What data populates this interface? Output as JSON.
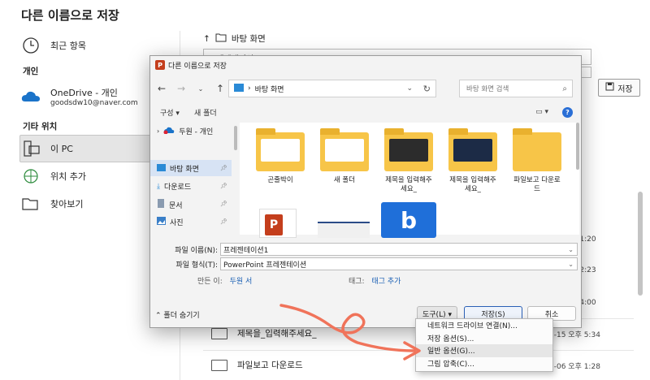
{
  "backstage": {
    "title": "다른 이름으로 저장",
    "recent": "최근 항목",
    "personal_header": "개인",
    "onedrive_name": "OneDrive - 개인",
    "onedrive_email": "goodsdw10@naver.com",
    "other_header": "기타 위치",
    "this_pc": "이 PC",
    "add_location": "위치 추가",
    "browse": "찾아보기",
    "path": "바탕 화면",
    "filename_value": "프레젠테이션1",
    "save_button": "저장",
    "files": [
      {
        "name": "제목을_입력해주세요_",
        "date": "3-15 오후 5:34"
      },
      {
        "name": "파일보고 다운로드",
        "date": "3-06 오후 1:28"
      }
    ],
    "dates": [
      "오후 1:20",
      "오후 2:23",
      "오후 4:00"
    ]
  },
  "dialog": {
    "title": "다른 이름으로 저장",
    "address": "바탕 화면",
    "search_placeholder": "바탕 화면 검색",
    "organize": "구성 ▾",
    "new_folder": "새 폴더",
    "nav": [
      {
        "label": "두원 - 개인"
      },
      {
        "label": "바탕 화면"
      },
      {
        "label": "다운로드"
      },
      {
        "label": "문서"
      },
      {
        "label": "사진"
      }
    ],
    "folders": [
      {
        "label": "곤줄박이"
      },
      {
        "label": "새 폴더"
      },
      {
        "label": "제목을 입력해주세요_"
      },
      {
        "label": "제목을 입력해주세요_"
      },
      {
        "label": "파일보고 다운로드"
      }
    ],
    "filename_label": "파일 이름(N):",
    "filename_value": "프레젠테이션1",
    "filetype_label": "파일 형식(T):",
    "filetype_value": "PowerPoint 프레젠테이션",
    "author_label": "만든 이:",
    "author_value": "두원 서",
    "tags_label": "태그:",
    "tags_value": "태그 추가",
    "hide_folders": "폴더 숨기기",
    "tools": "도구(L) ▾",
    "save": "저장(S)",
    "cancel": "취소"
  },
  "tools_menu": [
    {
      "label": "네트워크 드라이브 연결(N)..."
    },
    {
      "label": "저장 옵션(S)..."
    },
    {
      "label": "일반 옵션(G)..."
    },
    {
      "label": "그림 압축(C)..."
    }
  ],
  "colors": {
    "accent": "#2a6fd6",
    "folder": "#f7c548",
    "annotation_arrow": "#f0735a",
    "ppt": "#c43e1c"
  }
}
